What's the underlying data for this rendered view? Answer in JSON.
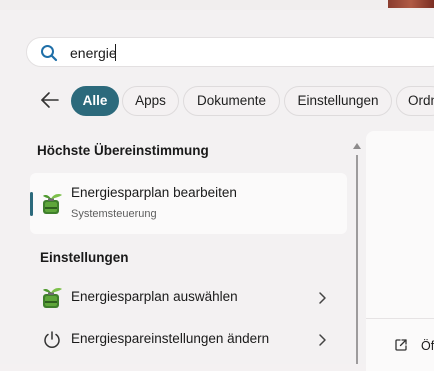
{
  "search": {
    "value": "energie"
  },
  "filters": [
    {
      "label": "Alle",
      "active": true
    },
    {
      "label": "Apps"
    },
    {
      "label": "Dokumente"
    },
    {
      "label": "Einstellungen"
    },
    {
      "label": "Ordn"
    }
  ],
  "best_match": {
    "heading": "Höchste Übereinstimmung",
    "title": "Energiesparplan bearbeiten",
    "subtitle": "Systemsteuerung"
  },
  "settings": {
    "heading": "Einstellungen",
    "items": [
      {
        "label": "Energiesparplan auswählen",
        "icon": "battery-plant-icon"
      },
      {
        "label": "Energiespareinstellungen ändern",
        "icon": "power-icon"
      }
    ]
  },
  "preview": {
    "open_label": "Öf"
  },
  "colors": {
    "accent": "#2c6a7c",
    "background": "#f3f1f2"
  }
}
